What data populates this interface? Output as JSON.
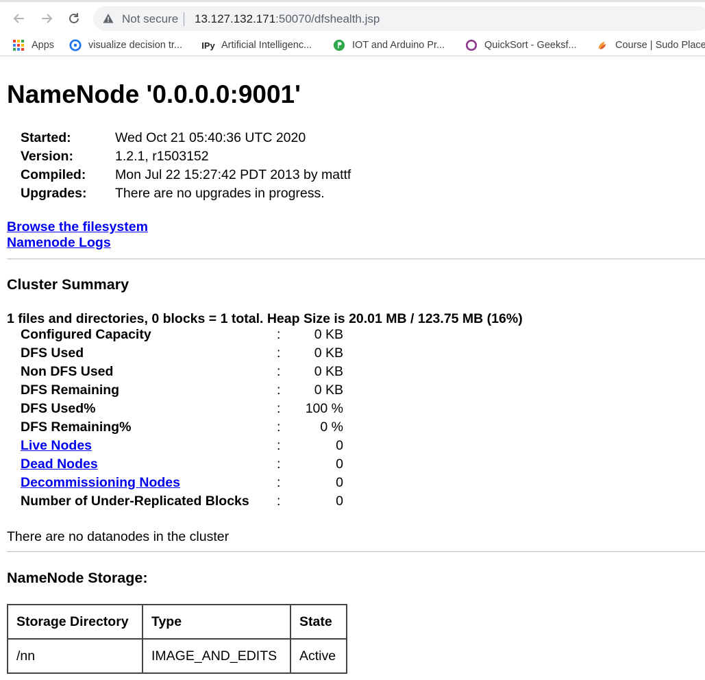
{
  "browser": {
    "insecure_label": "Not secure",
    "url_host": "13.127.132.171",
    "url_rest": ":50070/dfshealth.jsp",
    "bookmarks": [
      {
        "label": "Apps",
        "icon": "apps-grid-icon"
      },
      {
        "label": "visualize decision tr...",
        "icon": "decision-tree-icon"
      },
      {
        "label": "Artificial Intelligenc...",
        "icon": "ipy-icon"
      },
      {
        "label": "IOT and Arduino Pr...",
        "icon": "iot-icon"
      },
      {
        "label": "QuickSort - Geeksf...",
        "icon": "quicksort-icon"
      },
      {
        "label": "Course | Sudo Place",
        "icon": "sudo-place-icon"
      }
    ]
  },
  "page": {
    "title": "NameNode '0.0.0.0:9001'",
    "info": [
      {
        "label": "Started:",
        "value": "Wed Oct 21 05:40:36 UTC 2020"
      },
      {
        "label": "Version:",
        "value": "1.2.1, r1503152"
      },
      {
        "label": "Compiled:",
        "value": "Mon Jul 22 15:27:42 PDT 2013 by mattf"
      },
      {
        "label": "Upgrades:",
        "value": "There are no upgrades in progress."
      }
    ],
    "links": {
      "browse": "Browse the filesystem",
      "logs": "Namenode Logs"
    },
    "cluster": {
      "heading": "Cluster Summary",
      "summary_line": "1 files and directories, 0 blocks = 1 total. Heap Size is 20.01 MB / 123.75 MB (16%)",
      "stats": [
        {
          "label": "Configured Capacity",
          "value": "0 KB",
          "link": false
        },
        {
          "label": "DFS Used",
          "value": "0 KB",
          "link": false
        },
        {
          "label": "Non DFS Used",
          "value": "0 KB",
          "link": false
        },
        {
          "label": "DFS Remaining",
          "value": "0 KB",
          "link": false
        },
        {
          "label": "DFS Used%",
          "value": "100 %",
          "link": false
        },
        {
          "label": "DFS Remaining%",
          "value": "0 %",
          "link": false
        },
        {
          "label": "Live Nodes",
          "value": "0",
          "link": true
        },
        {
          "label": "Dead Nodes",
          "value": "0",
          "link": true
        },
        {
          "label": "Decommissioning Nodes",
          "value": "0",
          "link": true
        },
        {
          "label": "Number of Under-Replicated Blocks",
          "value": "0",
          "link": false
        }
      ],
      "separator": ":",
      "no_datanodes": "There are no datanodes in the cluster"
    },
    "storage": {
      "heading": "NameNode Storage:",
      "columns": [
        "Storage Directory",
        "Type",
        "State"
      ],
      "rows": [
        [
          "/nn",
          "IMAGE_AND_EDITS",
          "Active"
        ]
      ]
    }
  }
}
